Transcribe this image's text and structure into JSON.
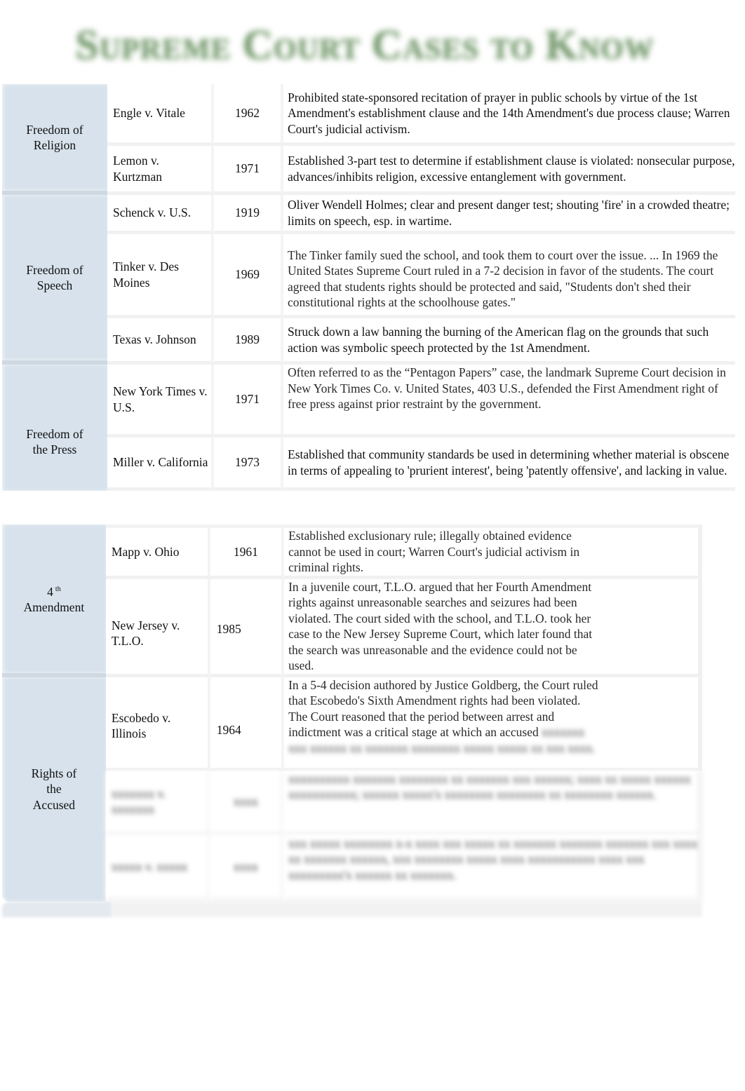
{
  "title": "Supreme Court Cases to Know",
  "tables": [
    {
      "sections": [
        {
          "category": "Freedom of Religion",
          "cases": [
            {
              "name": "Engle v. Vitale",
              "year": "1962",
              "description": "Prohibited state-sponsored recitation of prayer in public schools by virtue of the 1st Amendment's establishment clause and the 14th Amendment's due process clause; Warren Court's judicial activism."
            },
            {
              "name": "Lemon v. Kurtzman",
              "year": "1971",
              "description": "Established 3-part test to determine if establishment clause is violated: nonsecular purpose, advances/inhibits religion, excessive entanglement with government."
            }
          ]
        },
        {
          "category": "Freedom of Speech",
          "cases": [
            {
              "name": "Schenck v. U.S.",
              "year": "1919",
              "description": "Oliver Wendell Holmes; clear and present danger test; shouting 'fire' in a crowded theatre; limits on speech, esp. in wartime."
            },
            {
              "name": "Tinker v. Des Moines",
              "year": "1969",
              "description": "The Tinker family sued the school, and took them to court over the issue. ... In 1969 the United States Supreme Court ruled in a 7-2 decision in favor of the students. The court agreed that students rights should be protected and said, \"Students don't shed their constitutional rights at the schoolhouse gates.\""
            },
            {
              "name": "Texas v. Johnson",
              "year": "1989",
              "description": "Struck down a law banning the burning of the American flag on the grounds that such action was symbolic speech protected by the 1st Amendment."
            }
          ]
        },
        {
          "category": "Freedom of the Press",
          "cases": [
            {
              "name": "New York Times v. U.S.",
              "year": "1971",
              "description": "Often referred to as the “Pentagon Papers” case, the landmark Supreme Court decision in New York Times Co. v. United States, 403 U.S., defended the First Amendment right of free press against prior restraint by the government."
            },
            {
              "name": "Miller v. California",
              "year": "1973",
              "description": "Established that community standards be used in determining whether material is obscene in terms of appealing to 'prurient interest', being 'patently offensive', and lacking in value."
            }
          ]
        }
      ]
    },
    {
      "sections": [
        {
          "category_main": "4",
          "category_sup": "th",
          "category_rest": "Amendment",
          "cases": [
            {
              "name": "Mapp v. Ohio",
              "year": "1961",
              "description": "Established exclusionary rule; illegally obtained evidence cannot be used in court; Warren Court's judicial activism in criminal rights."
            },
            {
              "name": "New Jersey v. T.L.O.",
              "year": "1985",
              "description": "In a juvenile court, T.L.O. argued that her Fourth Amendment rights against unreasonable searches and seizures had been violated. The court sided with the school, and T.L.O. took her case to the New Jersey Supreme Court, which later found that the search was unreasonable and the evidence could not be used."
            }
          ]
        },
        {
          "category": "Rights of the Accused",
          "cases": [
            {
              "name": "Escobedo v. Illinois",
              "year": "1964",
              "description": "In a 5-4 decision authored by Justice Goldberg, the Court ruled that Escobedo's Sixth Amendment rights had been violated. The Court reasoned that the period between arrest and indictment was a critical stage at which an accused",
              "description_blurred": "xxxxxxx xxx xxxxxx xx xxxxxxx xxxxxxxx xxxxx xxxxx xx xxx xxxx."
            },
            {
              "name": "xxxxxxx v. xxxxxxx",
              "year": "xxxx",
              "description": "xxxxxxxxxx xxxxxxx xxxxxxxx xx xxxxxxx xxx xxxxxx; xxxx xx xxxxx xxxxxx xxxxxxxxxxx; xxxxxx xxxxx'x xxxxxxxx xxxxxxxx xx xxxxxxxx xxxxxx.",
              "obscured": true
            },
            {
              "name": "xxxxx v. xxxxx",
              "year": "xxxx",
              "description": "xxx xxxxx xxxxxxxx x-x xxxx xxx xxxxx xx xxxxxxx xxxxxxx xxxxxxx xxx xxxx xx xxxxxxx xxxxxx, xxx xxxxxxxx xxxxx xxxx xxxxxxxxxxx xxxx xxx xxxxxxxxx'x xxxxxx xx xxxxxxx.",
              "obscured": true
            }
          ]
        }
      ]
    }
  ]
}
